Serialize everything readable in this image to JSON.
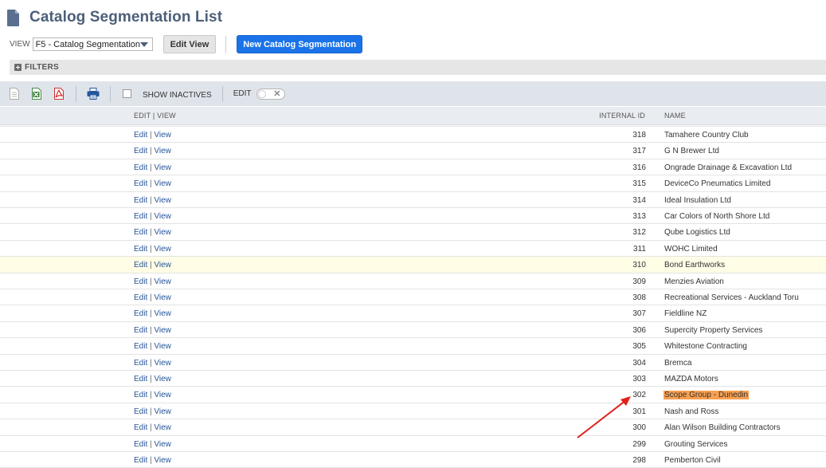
{
  "page": {
    "title": "Catalog Segmentation List",
    "view_label": "VIEW",
    "view_selected": "F5 - Catalog Segmentation",
    "edit_view_button": "Edit View",
    "new_button": "New Catalog Segmentation",
    "filters_label": "FILTERS"
  },
  "toolbar": {
    "show_inactives_label": "SHOW INACTIVES",
    "edit_label": "EDIT"
  },
  "table": {
    "columns": {
      "edit_view": "EDIT | VIEW",
      "internal_id": "INTERNAL ID",
      "name": "NAME"
    },
    "edit_link": "Edit",
    "separator": "|",
    "view_link": "View",
    "rows": [
      {
        "id": "318",
        "name": "Tamahere Country Club"
      },
      {
        "id": "317",
        "name": "G N Brewer Ltd"
      },
      {
        "id": "316",
        "name": "Ongrade Drainage & Excavation Ltd"
      },
      {
        "id": "315",
        "name": "DeviceCo Pneumatics Limited"
      },
      {
        "id": "314",
        "name": "Ideal Insulation Ltd"
      },
      {
        "id": "313",
        "name": "Car Colors of North Shore Ltd"
      },
      {
        "id": "312",
        "name": "Qube Logistics Ltd"
      },
      {
        "id": "311",
        "name": "WOHC Limited"
      },
      {
        "id": "310",
        "name": "Bond Earthworks"
      },
      {
        "id": "309",
        "name": "Menzies Aviation"
      },
      {
        "id": "308",
        "name": "Recreational Services - Auckland Toru"
      },
      {
        "id": "307",
        "name": "Fieldline NZ"
      },
      {
        "id": "306",
        "name": "Supercity Property Services"
      },
      {
        "id": "305",
        "name": "Whitestone Contracting"
      },
      {
        "id": "304",
        "name": "Bremca"
      },
      {
        "id": "303",
        "name": "MAZDA Motors"
      },
      {
        "id": "302",
        "name": "Scope Group - Dunedin"
      },
      {
        "id": "301",
        "name": "Nash and Ross"
      },
      {
        "id": "300",
        "name": "Alan Wilson Building Contractors"
      },
      {
        "id": "299",
        "name": "Grouting Services"
      },
      {
        "id": "298",
        "name": "Pemberton Civil"
      }
    ],
    "hovered_row_id": "310",
    "highlighted_row_id": "302"
  },
  "colors": {
    "title": "#4d5f79",
    "primary_button": "#1a73e8",
    "link": "#255599",
    "highlight": "#f8a050",
    "annotation_arrow": "#e0201c"
  }
}
